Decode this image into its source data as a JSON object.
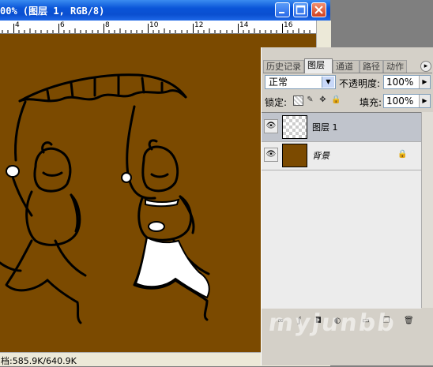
{
  "window": {
    "title": "00% (图层 1, RGB/8)",
    "buttons": {
      "minimize": "_",
      "maximize": "□",
      "close": "✕"
    }
  },
  "ruler": {
    "labels": [
      "4",
      "6",
      "8",
      "10",
      "12",
      "14",
      "16"
    ]
  },
  "canvas": {
    "background_color": "#7b4a00"
  },
  "status": {
    "text": "档:585.9K/640.9K"
  },
  "layers_panel": {
    "tabs": [
      {
        "label": "历史记录",
        "active": false
      },
      {
        "label": "图层",
        "active": true
      },
      {
        "label": "通道",
        "active": false
      },
      {
        "label": "路径",
        "active": false
      },
      {
        "label": "动作",
        "active": false
      }
    ],
    "menu_icon": "▸",
    "blend_mode": "正常",
    "opacity_label": "不透明度:",
    "opacity_value": "100%",
    "lock_label": "锁定:",
    "fill_label": "填充:",
    "fill_value": "100%",
    "layers": [
      {
        "name": "图层 1",
        "selected": true,
        "visible": true,
        "thumbnail": "transparent"
      },
      {
        "name": "背景",
        "selected": false,
        "visible": true,
        "thumbnail": "brown",
        "locked": true
      }
    ]
  },
  "watermark": "myjunbb"
}
